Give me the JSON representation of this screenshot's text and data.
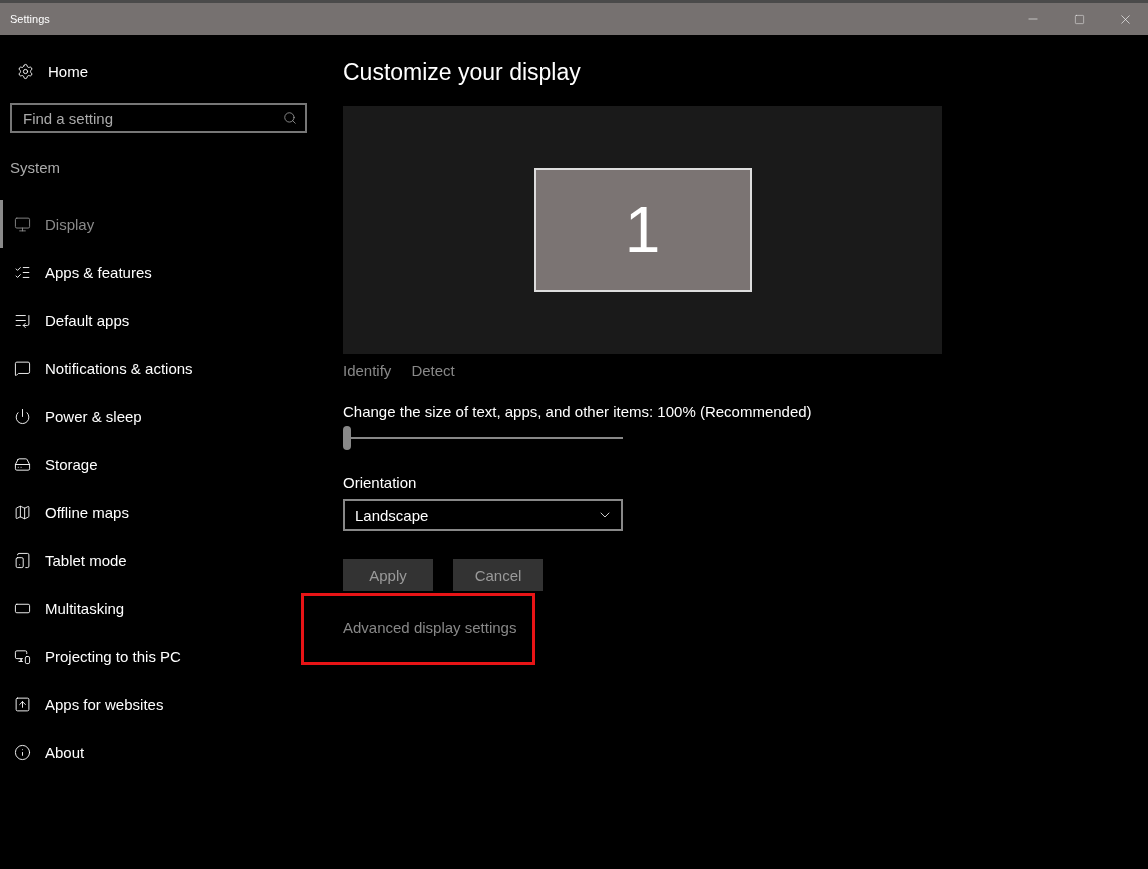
{
  "window": {
    "title": "Settings"
  },
  "sidebar": {
    "home": "Home",
    "search": {
      "placeholder": "Find a setting"
    },
    "section": "System",
    "items": [
      {
        "label": "Display",
        "selected": true
      },
      {
        "label": "Apps & features",
        "selected": false
      },
      {
        "label": "Default apps",
        "selected": false
      },
      {
        "label": "Notifications & actions",
        "selected": false
      },
      {
        "label": "Power & sleep",
        "selected": false
      },
      {
        "label": "Storage",
        "selected": false
      },
      {
        "label": "Offline maps",
        "selected": false
      },
      {
        "label": "Tablet mode",
        "selected": false
      },
      {
        "label": "Multitasking",
        "selected": false
      },
      {
        "label": "Projecting to this PC",
        "selected": false
      },
      {
        "label": "Apps for websites",
        "selected": false
      },
      {
        "label": "About",
        "selected": false
      }
    ]
  },
  "main": {
    "title": "Customize your display",
    "monitor": "1",
    "links": [
      "Identify",
      "Detect"
    ],
    "scale": {
      "label": "Change the size of text, apps, and other items: 100% (Recommended)",
      "level": 0
    },
    "orientation": {
      "label": "Orientation",
      "value": "Landscape"
    },
    "buttons": [
      {
        "label": "Apply",
        "disabled": true
      },
      {
        "label": "Cancel",
        "disabled": true
      }
    ],
    "advanced_link": "Advanced display settings"
  }
}
